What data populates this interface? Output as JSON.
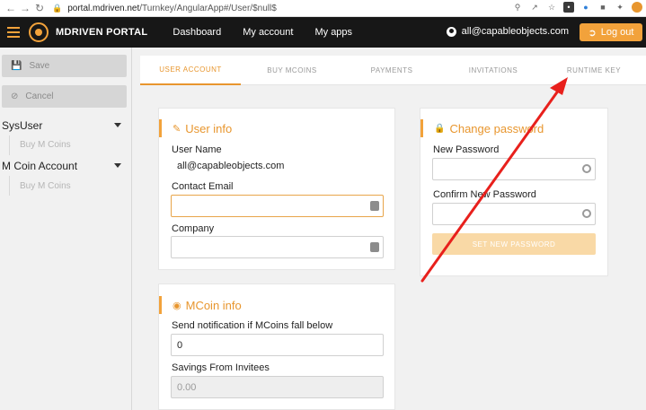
{
  "browser": {
    "url_host": "portal.mdriven.net",
    "url_path": "/Turnkey/AngularApp#/User/$null$"
  },
  "header": {
    "brand": "MDRIVEN PORTAL",
    "nav": [
      "Dashboard",
      "My account",
      "My apps"
    ],
    "user_email": "all@capableobjects.com",
    "logout_label": "Log out"
  },
  "sidebar": {
    "save_label": "Save",
    "cancel_label": "Cancel",
    "groups": [
      {
        "label": "SysUser",
        "items": [
          "Buy M Coins"
        ]
      },
      {
        "label": "M Coin Account",
        "items": [
          "Buy M Coins"
        ]
      }
    ]
  },
  "tabs": [
    "USER ACCOUNT",
    "BUY MCOINS",
    "PAYMENTS",
    "INVITATIONS",
    "RUNTIME KEY"
  ],
  "user_info": {
    "title": "User info",
    "username_label": "User Name",
    "username_value": "all@capableobjects.com",
    "contact_email_label": "Contact Email",
    "contact_email_value": "",
    "company_label": "Company",
    "company_value": ""
  },
  "mcoin_info": {
    "title": "MCoin info",
    "notify_label": "Send notification if MCoins fall below",
    "notify_value": "0",
    "savings_label": "Savings From Invitees",
    "savings_value": "0.00"
  },
  "change_password": {
    "title": "Change password",
    "new_password_label": "New Password",
    "confirm_password_label": "Confirm New Password",
    "set_button_label": "SET NEW PASSWORD"
  },
  "colors": {
    "accent": "#f2a23b",
    "header_bg": "#171717",
    "annotation_arrow": "#e8201c"
  }
}
